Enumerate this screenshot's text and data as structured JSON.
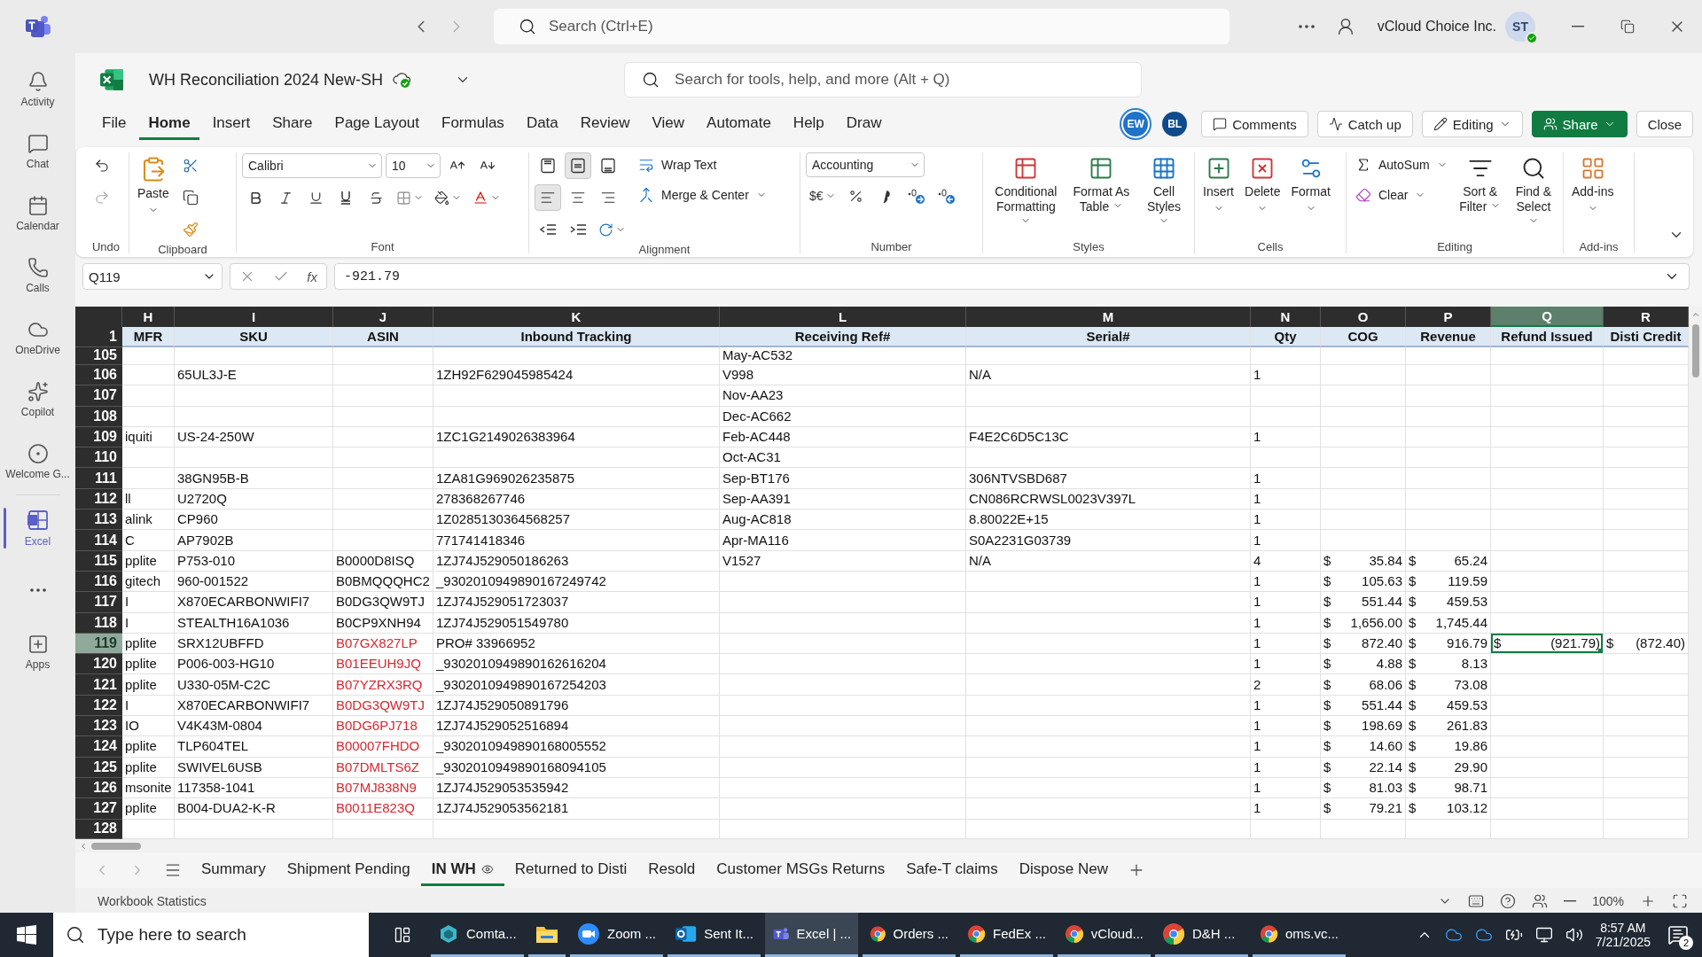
{
  "teams_bar": {
    "search": {
      "placeholder": "Search (Ctrl+E)"
    },
    "org": "vCloud Choice Inc.",
    "avatar": "ST"
  },
  "rail": [
    {
      "kind": "activity",
      "label": "Activity",
      "selected": false
    },
    {
      "kind": "chat",
      "label": "Chat",
      "selected": false
    },
    {
      "kind": "calendar",
      "label": "Calendar",
      "selected": false
    },
    {
      "kind": "calls",
      "label": "Calls",
      "selected": false
    },
    {
      "kind": "onedrive",
      "label": "OneDrive",
      "selected": false
    },
    {
      "kind": "copilot",
      "label": "Copilot",
      "selected": false
    },
    {
      "kind": "welcome",
      "label": "Welcome G...",
      "selected": false
    },
    {
      "kind": "excel",
      "label": "Excel",
      "selected": true
    },
    {
      "kind": "more",
      "selected": false
    },
    {
      "kind": "apps",
      "label": "Apps",
      "selected": false
    }
  ],
  "workbook": {
    "title": "WH Reconciliation 2024 New-SH",
    "search": {
      "placeholder": "Search for tools, help, and more (Alt + Q)"
    }
  },
  "menu_tabs": [
    {
      "label": "File",
      "selected": false
    },
    {
      "label": "Home",
      "selected": true
    },
    {
      "label": "Insert",
      "selected": false
    },
    {
      "label": "Share",
      "selected": false
    },
    {
      "label": "Page Layout",
      "selected": false
    },
    {
      "label": "Formulas",
      "selected": false
    },
    {
      "label": "Data",
      "selected": false
    },
    {
      "label": "Review",
      "selected": false
    },
    {
      "label": "View",
      "selected": false
    },
    {
      "label": "Automate",
      "selected": false
    },
    {
      "label": "Help",
      "selected": false
    },
    {
      "label": "Draw",
      "selected": false
    }
  ],
  "collaborators": [
    {
      "initials": "EW",
      "selected": true
    },
    {
      "initials": "BL",
      "selected": false
    }
  ],
  "actions": [
    {
      "kind": "comments",
      "label": "Comments"
    },
    {
      "kind": "catchup",
      "label": "Catch up"
    },
    {
      "kind": "editing",
      "label": "Editing"
    },
    {
      "kind": "share",
      "label": "Share"
    },
    {
      "kind": "close",
      "label": "Close"
    }
  ],
  "ribbon": [
    {
      "kind": "undo",
      "label": "Undo"
    },
    {
      "kind": "clipboard",
      "label": "Clipboard",
      "paste": "Paste"
    },
    {
      "kind": "font",
      "label": "Font",
      "font": "Calibri",
      "size": "10"
    },
    {
      "kind": "alignment",
      "label": "Alignment",
      "wrap": "Wrap Text",
      "merge": "Merge & Center",
      "buttons": [
        {
          "kind": "top",
          "selected": false
        },
        {
          "kind": "middle",
          "selected": true
        },
        {
          "kind": "bottom",
          "selected": false
        },
        {
          "kind": "left",
          "selected": true
        },
        {
          "kind": "center",
          "selected": false
        },
        {
          "kind": "right",
          "selected": false
        }
      ]
    },
    {
      "kind": "number",
      "label": "Number",
      "format": "Accounting",
      "currency": "$€"
    },
    {
      "kind": "styles",
      "label": "Styles",
      "buttons": [
        "Conditional Formatting",
        "Format As Table",
        "Cell Styles"
      ]
    },
    {
      "kind": "cells",
      "label": "Cells",
      "buttons": [
        "Insert",
        "Delete",
        "Format"
      ]
    },
    {
      "kind": "editing",
      "label": "Editing",
      "autosum": "AutoSum",
      "clear": "Clear",
      "buttons": [
        "Sort & Filter",
        "Find & Select"
      ]
    },
    {
      "kind": "addins",
      "label": "Add-ins",
      "buttons": [
        "Add-ins"
      ]
    }
  ],
  "formula_bar": {
    "cell": "Q119",
    "function_label": "fx",
    "value": "-921.79"
  },
  "grid": {
    "columns": [
      {
        "letter": "H",
        "selected": false
      },
      {
        "letter": "I",
        "selected": false
      },
      {
        "letter": "J",
        "selected": false
      },
      {
        "letter": "K",
        "selected": false
      },
      {
        "letter": "L",
        "selected": false
      },
      {
        "letter": "M",
        "selected": false
      },
      {
        "letter": "N",
        "selected": false
      },
      {
        "letter": "O",
        "selected": false
      },
      {
        "letter": "P",
        "selected": false
      },
      {
        "letter": "Q",
        "selected": true
      },
      {
        "letter": "R",
        "selected": false
      }
    ],
    "header_row": {
      "number": "1",
      "cells": {
        "H": "MFR",
        "I": "SKU",
        "J": "ASIN",
        "K": "Inbound Tracking",
        "L": "Receiving Ref#",
        "M": "Serial#",
        "N": "Qty",
        "O": "COG",
        "P": "Revenue",
        "Q": "Refund Issued",
        "R": "Disti Credit"
      }
    },
    "rows": [
      {
        "number": "105",
        "selected": false,
        "cells": {
          "L": "May-AC532"
        }
      },
      {
        "number": "106",
        "selected": false,
        "cells": {
          "I": "65UL3J-E",
          "K": "1ZH92F629045985424",
          "L": "V998",
          "M": "N/A",
          "N": "1"
        }
      },
      {
        "number": "107",
        "selected": false,
        "cells": {
          "L": "Nov-AA23"
        }
      },
      {
        "number": "108",
        "selected": false,
        "cells": {
          "L": "Dec-AC662"
        }
      },
      {
        "number": "109",
        "selected": false,
        "cells": {
          "H": "iquiti",
          "I": "US-24-250W",
          "K": "1ZC1G2149026383964",
          "L": "Feb-AC448",
          "M": "F4E2C6D5C13C",
          "N": "1"
        }
      },
      {
        "number": "110",
        "selected": false,
        "cells": {
          "L": "Oct-AC31"
        }
      },
      {
        "number": "111",
        "selected": false,
        "cells": {
          "I": "38GN95B-B",
          "K": "1ZA81G969026235875",
          "L": "Sep-BT176",
          "M": "306NTVSBD687",
          "N": "1"
        }
      },
      {
        "number": "112",
        "selected": false,
        "cells": {
          "H": "ll",
          "I": "U2720Q",
          "K": "278368267746",
          "L": "Sep-AA391",
          "M": "CN086RCRWSL0023V397L",
          "N": "1"
        }
      },
      {
        "number": "113",
        "selected": false,
        "cells": {
          "H": "alink",
          "I": "CP960",
          "K": "1Z0285130364568257",
          "L": "Aug-AC818",
          "M": "8.80022E+15",
          "N": "1"
        }
      },
      {
        "number": "114",
        "selected": false,
        "cells": {
          "H": "C",
          "I": "AP7902B",
          "K": "771741418346",
          "L": "Apr-MA116",
          "M": "S0A2231G03739",
          "N": "1"
        }
      },
      {
        "number": "115",
        "selected": false,
        "cells": {
          "H": "pplite",
          "I": "P753-010",
          "J": "B0000D8ISQ",
          "K": "1ZJ74J529050186263",
          "L": "V1527",
          "M": "N/A",
          "N": "4",
          "O": {
            "currency": "$",
            "text": "35.84"
          },
          "P": {
            "currency": "$",
            "text": "65.24"
          }
        }
      },
      {
        "number": "116",
        "selected": false,
        "cells": {
          "H": "gitech",
          "I": "960-001522",
          "J": "B0BMQQQHC2",
          "K": "_9302010949890167249742",
          "N": "1",
          "O": {
            "currency": "$",
            "text": "105.63"
          },
          "P": {
            "currency": "$",
            "text": "119.59"
          }
        }
      },
      {
        "number": "117",
        "selected": false,
        "cells": {
          "H": "I",
          "I": "X870ECARBONWIFI7",
          "J": "B0DG3QW9TJ",
          "K": "1ZJ74J529051723037",
          "N": "1",
          "O": {
            "currency": "$",
            "text": "551.44"
          },
          "P": {
            "currency": "$",
            "text": "459.53"
          }
        }
      },
      {
        "number": "118",
        "selected": false,
        "cells": {
          "H": "I",
          "I": "STEALTH16A1036",
          "J": "B0CP9XNH94",
          "K": "1ZJ74J529051549780",
          "N": "1",
          "O": {
            "currency": "$",
            "text": "1,656.00"
          },
          "P": {
            "currency": "$",
            "text": "1,745.44"
          }
        }
      },
      {
        "number": "119",
        "selected": true,
        "cells": {
          "H": "pplite",
          "I": "SRX12UBFFD",
          "J": {
            "text": "B07GX827LP",
            "color": "#d9272e"
          },
          "K": "PRO# 33966952",
          "N": "1",
          "O": {
            "currency": "$",
            "text": "872.40"
          },
          "P": {
            "currency": "$",
            "text": "916.79"
          },
          "Q": {
            "currency": "$",
            "text": "(921.79)",
            "active": true
          },
          "R": {
            "currency": "$",
            "text": "(872.40)"
          }
        }
      },
      {
        "number": "120",
        "selected": false,
        "cells": {
          "H": "pplite",
          "I": "P006-003-HG10",
          "J": {
            "text": "B01EEUH9JQ",
            "color": "#d9272e"
          },
          "K": "_9302010949890162616204",
          "N": "1",
          "O": {
            "currency": "$",
            "text": "4.88"
          },
          "P": {
            "currency": "$",
            "text": "8.13"
          }
        }
      },
      {
        "number": "121",
        "selected": false,
        "cells": {
          "H": "pplite",
          "I": "U330-05M-C2C",
          "J": {
            "text": "B07YZRX3RQ",
            "color": "#d9272e"
          },
          "K": "_9302010949890167254203",
          "N": "2",
          "O": {
            "currency": "$",
            "text": "68.06"
          },
          "P": {
            "currency": "$",
            "text": "73.08"
          }
        }
      },
      {
        "number": "122",
        "selected": false,
        "cells": {
          "H": "I",
          "I": "X870ECARBONWIFI7",
          "J": {
            "text": "B0DG3QW9TJ",
            "color": "#d9272e"
          },
          "K": "1ZJ74J529050891796",
          "N": "1",
          "O": {
            "currency": "$",
            "text": "551.44"
          },
          "P": {
            "currency": "$",
            "text": "459.53"
          }
        }
      },
      {
        "number": "123",
        "selected": false,
        "cells": {
          "H": "IO",
          "I": "V4K43M-0804",
          "J": {
            "text": "B0DG6PJ718",
            "color": "#d9272e"
          },
          "K": "1ZJ74J529052516894",
          "N": "1",
          "O": {
            "currency": "$",
            "text": "198.69"
          },
          "P": {
            "currency": "$",
            "text": "261.83"
          }
        }
      },
      {
        "number": "124",
        "selected": false,
        "cells": {
          "H": "pplite",
          "I": "TLP604TEL",
          "J": {
            "text": "B00007FHDO",
            "color": "#d9272e"
          },
          "K": "_9302010949890168005552",
          "N": "1",
          "O": {
            "currency": "$",
            "text": "14.60"
          },
          "P": {
            "currency": "$",
            "text": "19.86"
          }
        }
      },
      {
        "number": "125",
        "selected": false,
        "cells": {
          "H": "pplite",
          "I": "SWIVEL6USB",
          "J": {
            "text": "B07DMLTS6Z",
            "color": "#d9272e"
          },
          "K": "_9302010949890168094105",
          "N": "1",
          "O": {
            "currency": "$",
            "text": "22.14"
          },
          "P": {
            "currency": "$",
            "text": "29.90"
          }
        }
      },
      {
        "number": "126",
        "selected": false,
        "cells": {
          "H": "msonite",
          "I": "117358-1041",
          "J": {
            "text": "B07MJ838N9",
            "color": "#d9272e"
          },
          "K": "1ZJ74J529053535942",
          "N": "1",
          "O": {
            "currency": "$",
            "text": "81.03"
          },
          "P": {
            "currency": "$",
            "text": "98.71"
          }
        }
      },
      {
        "number": "127",
        "selected": false,
        "cells": {
          "H": "pplite",
          "I": "B004-DUA2-K-R",
          "J": {
            "text": "B0011E823Q",
            "color": "#d9272e"
          },
          "K": "1ZJ74J529053562181",
          "N": "1",
          "O": {
            "currency": "$",
            "text": "79.21"
          },
          "P": {
            "currency": "$",
            "text": "103.12"
          }
        }
      },
      {
        "number": "128",
        "selected": false,
        "cells": {}
      }
    ]
  },
  "sheets": [
    {
      "label": "Summary",
      "selected": false
    },
    {
      "label": "Shipment Pending",
      "selected": false
    },
    {
      "label": "IN WH",
      "selected": true
    },
    {
      "label": "Returned to Disti",
      "selected": false
    },
    {
      "label": "Resold",
      "selected": false
    },
    {
      "label": "Customer MSGs Returns",
      "selected": false
    },
    {
      "label": "Safe-T claims",
      "selected": false
    },
    {
      "label": "Dispose New",
      "selected": false
    }
  ],
  "status": {
    "text": "Workbook Statistics",
    "zoom": "100%"
  },
  "taskbar": {
    "search": {
      "placeholder": "Type here to search"
    },
    "apps": [
      {
        "kind": "comta",
        "label": "Comta...",
        "selected": false
      },
      {
        "kind": "explorer",
        "selected": false
      },
      {
        "kind": "zoom",
        "label": "Zoom ...",
        "selected": false
      },
      {
        "kind": "outlook",
        "label": "Sent It...",
        "selected": false
      },
      {
        "kind": "teams",
        "label": "Excel | ...",
        "selected": true
      },
      {
        "kind": "chrome",
        "label": "Orders ...",
        "selected": false
      },
      {
        "kind": "chrome",
        "label": "FedEx ...",
        "selected": false
      },
      {
        "kind": "chrome",
        "label": "vCloud...",
        "selected": false
      },
      {
        "kind": "chrome",
        "label": "D&H ...",
        "selected": false
      },
      {
        "kind": "chrome",
        "label": "oms.vc...",
        "selected": false
      }
    ],
    "time": "8:57 AM",
    "date": "7/21/2025",
    "notifications": "2"
  }
}
